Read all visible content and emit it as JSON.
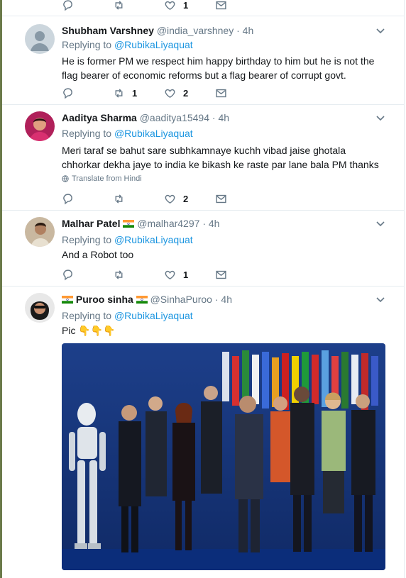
{
  "top_actions": {
    "like_count": "1"
  },
  "tweets": [
    {
      "name": "Shubham Varshney",
      "handle": "@india_varshney",
      "time": "4h",
      "replying_to": "",
      "text": "He is former PM we respect him happy birthday to him but he is not the flag bearer of economic reforms but a flag bearer of corrupt govt.",
      "retweets": "1",
      "likes": "2"
    },
    {
      "name": "Aaditya Sharma",
      "handle": "@aaditya15494",
      "time": "4h",
      "replying_label": "Replying to",
      "replying_to": "@RubikaLiyaquat",
      "text": "Meri taraf se bahut sare subhkamnaye kuchh vibad jaise ghotala chhorkar dekha jaye to india ke bikash ke raste par lane bala PM thanks",
      "translate": "Translate from Hindi",
      "retweets": "",
      "likes": "2"
    },
    {
      "name": "Malhar Patel",
      "handle": "@malhar4297",
      "time": "4h",
      "replying_label": "Replying to",
      "replying_to": "@RubikaLiyaquat",
      "text": "And a Robot too",
      "retweets": "",
      "likes": "1"
    },
    {
      "name": "Puroo sinha",
      "handle": "@SinhaPuroo",
      "time": "4h",
      "replying_label": "Replying to",
      "replying_to": "@RubikaLiyaquat",
      "text": "Pic",
      "emoji": "👇👇👇"
    }
  ],
  "labels": {
    "dot": "·"
  },
  "colors": {
    "link": "#1b95e0",
    "muted": "#657786",
    "text": "#14171a",
    "separator": "#e6ecf0"
  }
}
